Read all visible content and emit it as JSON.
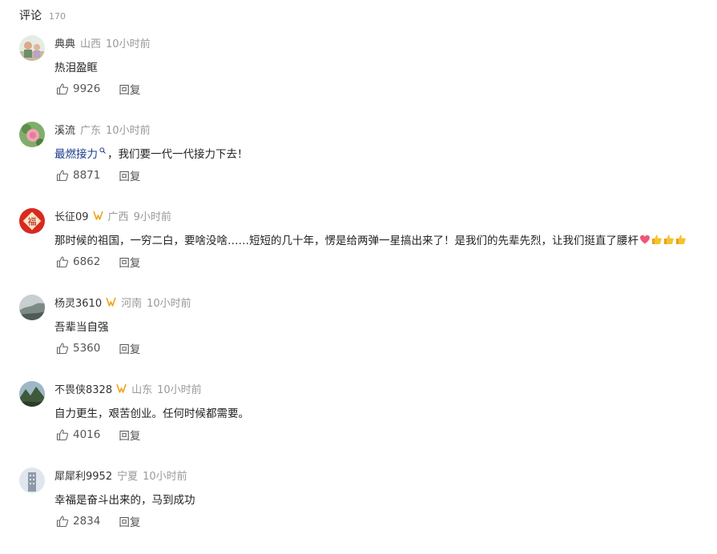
{
  "header": {
    "title": "评论",
    "count": "170"
  },
  "comments": [
    {
      "user": "典典",
      "verified": false,
      "region": "山西",
      "time": "10小时前",
      "text": "热泪盈眶",
      "likes": "9926",
      "reply": "回复",
      "avatar": "family-photo"
    },
    {
      "user": "溪流",
      "verified": false,
      "region": "广东",
      "time": "10小时前",
      "topic": "最燃接力",
      "text": "，我们要一代一代接力下去！",
      "likes": "8871",
      "reply": "回复",
      "avatar": "flower-photo"
    },
    {
      "user": "长征09",
      "verified": true,
      "region": "广西",
      "time": "9小时前",
      "text": "那时候的祖国，一穷二白，要啥没啥……短短的几十年，愣是给两弹一星搞出来了！是我们的先辈先烈，让我们挺直了腰杆",
      "emojis": [
        "heart-emoji",
        "thumbs-up-emoji",
        "thumbs-up-emoji",
        "thumbs-up-emoji"
      ],
      "likes": "6862",
      "reply": "回复",
      "avatar": "fu-character"
    },
    {
      "user": "杨灵3610",
      "verified": true,
      "region": "河南",
      "time": "10小时前",
      "text": "吾辈当自强",
      "likes": "5360",
      "reply": "回复",
      "avatar": "landscape-photo"
    },
    {
      "user": "不畏侠8328",
      "verified": true,
      "region": "山东",
      "time": "10小时前",
      "text": "自力更生，艰苦创业。任何时候都需要。",
      "likes": "4016",
      "reply": "回复",
      "avatar": "mountain-photo"
    },
    {
      "user": "犀犀利9952",
      "verified": false,
      "region": "宁夏",
      "time": "10小时前",
      "text": "幸福是奋斗出来的，马到成功",
      "likes": "2834",
      "reply": "回复",
      "avatar": "building-photo"
    }
  ],
  "colors": {
    "topic": "#1a3b8a",
    "verified_badge": "#f0a21a",
    "meta_gray": "#999999",
    "action_gray": "#555555"
  }
}
